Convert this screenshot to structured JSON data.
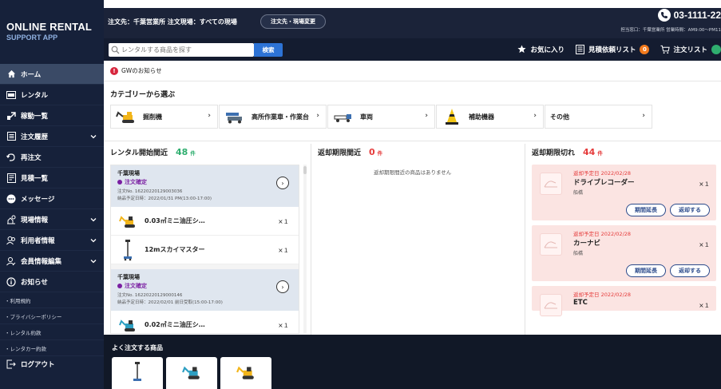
{
  "brand": {
    "line1": "ONLINE RENTAL",
    "line2": "SUPPORT APP"
  },
  "sidebar": {
    "items": [
      {
        "label": "ホーム",
        "icon": "home-icon"
      },
      {
        "label": "レンタル",
        "icon": "rent-icon"
      },
      {
        "label": "稼動一覧",
        "icon": "operation-icon"
      },
      {
        "label": "注文履歴",
        "icon": "history-icon"
      },
      {
        "label": "再注文",
        "icon": "reorder-icon"
      },
      {
        "label": "見積一覧",
        "icon": "estimate-icon"
      },
      {
        "label": "メッセージ",
        "icon": "message-icon"
      },
      {
        "label": "現場情報",
        "icon": "site-icon"
      },
      {
        "label": "利用者情報",
        "icon": "users-icon"
      },
      {
        "label": "会員情報編集",
        "icon": "member-icon"
      },
      {
        "label": "お知らせ",
        "icon": "info-icon"
      }
    ],
    "sub_links": [
      "利用規約",
      "プライバシーポリシー",
      "レンタル約款",
      "レンタカー約款"
    ],
    "logout": "ログアウト"
  },
  "header": {
    "order_to": "注文先：千葉営業所 注文現場：すべての現場",
    "change_button": "注文先・現場変更",
    "phone": "03-1111-22",
    "hours": "担当窓口：千葉営業所 営業時間：AM9:00〜PM11",
    "search_placeholder": "レンタルする商品を探す",
    "search_button": "検索",
    "favorites": "お気に入り",
    "estimate_list": "見積依頼リスト",
    "estimate_count": "0",
    "order_list": "注文リスト"
  },
  "notice": "GWのお知らせ",
  "categories_title": "カテゴリーから選ぶ",
  "categories": [
    {
      "label": "掘削機",
      "icon": "excavator-icon"
    },
    {
      "label": "高所作業車・作業台",
      "icon": "aerial-work-platform-icon"
    },
    {
      "label": "車両",
      "icon": "truck-icon"
    },
    {
      "label": "補助機器",
      "icon": "safety-cone-icon"
    },
    {
      "label": "その他",
      "icon": ""
    }
  ],
  "rental_soon": {
    "title": "レンタル開始間近",
    "count": "48",
    "unit": "件",
    "orders": [
      {
        "site": "千葉現場",
        "status": "注文確定",
        "order_no": "注文No. 16220220129003036",
        "delivery": "納品予定日時：2022/01/31  PM(13:00-17:00)",
        "items": [
          {
            "name": "0.03㎥ミニ油圧シ…",
            "qty": "×１",
            "icon": "mini-excavator-icon"
          },
          {
            "name": "12mスカイマスター",
            "qty": "×１",
            "icon": "sky-master-icon"
          }
        ]
      },
      {
        "site": "千葉現場",
        "status": "注文確定",
        "order_no": "注文No. 16220220129000146",
        "delivery": "納品予定日時：2022/02/01  前日受取(15:00-17:00)",
        "items": [
          {
            "name": "0.02㎥ミニ油圧シ…",
            "qty": "×１",
            "icon": "mini-excavator-icon"
          }
        ]
      }
    ]
  },
  "return_soon": {
    "title": "返却期限間近",
    "count": "0",
    "unit": "件",
    "empty": "返却期限間近の商品はありません"
  },
  "overdue": {
    "title": "返却期限切れ",
    "count": "44",
    "unit": "件",
    "extend_label": "期間延長",
    "return_label": "返却する",
    "items": [
      {
        "due": "返却予定日 2022/02/28",
        "name": "ドライブレコーダー",
        "location": "船橋",
        "qty": "×１"
      },
      {
        "due": "返却予定日 2022/02/28",
        "name": "カーナビ",
        "location": "船橋",
        "qty": "×１"
      },
      {
        "due": "返却予定日 2022/02/28",
        "name": "ETC",
        "location": "",
        "qty": "×１"
      }
    ]
  },
  "frequent": {
    "title": "よく注文する商品"
  },
  "colors": {
    "sidebar": "#16213a",
    "accent_blue": "#2d73d6",
    "green": "#2fae6f",
    "red": "#e53b3b",
    "overdue_bg": "#fbe4e2",
    "badge_orange": "#f17a1d"
  }
}
